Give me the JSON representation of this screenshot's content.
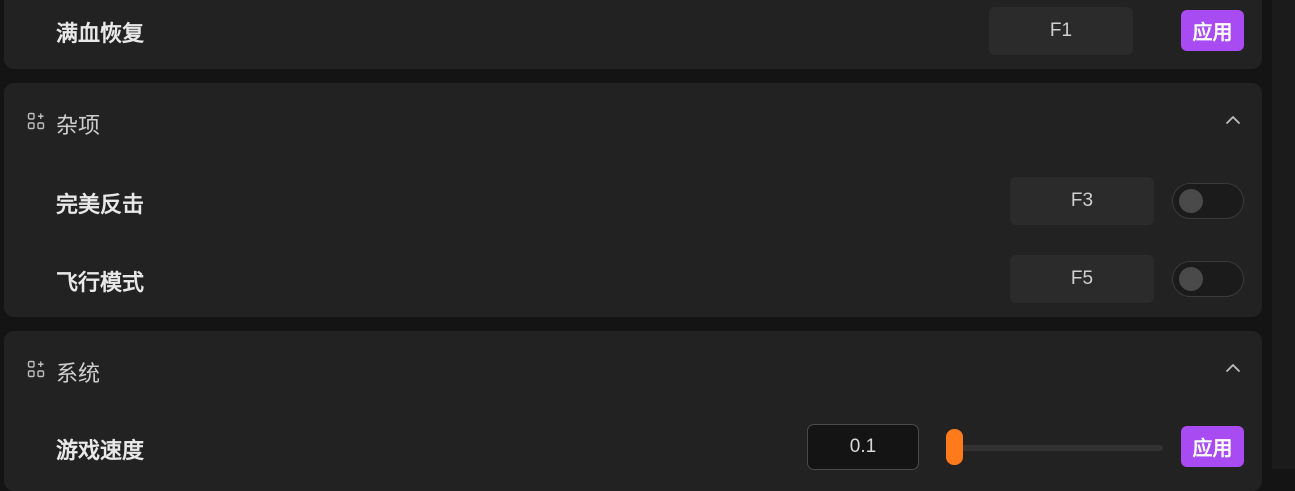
{
  "colors": {
    "accent_purple": "#a94bf2",
    "slider_orange": "#ff7a1a",
    "card_bg": "#222222",
    "page_bg": "#141414"
  },
  "hp_restore": {
    "label": "满血恢复",
    "hotkey": "F1",
    "apply_label": "应用"
  },
  "misc": {
    "title": "杂项",
    "icon": "apps-add-icon",
    "collapse_icon": "chevron-up-icon",
    "items": [
      {
        "label": "完美反击",
        "hotkey": "F3",
        "enabled": false
      },
      {
        "label": "飞行模式",
        "hotkey": "F5",
        "enabled": false
      }
    ]
  },
  "system": {
    "title": "系统",
    "icon": "apps-add-icon",
    "collapse_icon": "chevron-up-icon",
    "game_speed": {
      "label": "游戏速度",
      "value": "0.1",
      "slider_fraction": 0.0,
      "apply_label": "应用"
    }
  }
}
